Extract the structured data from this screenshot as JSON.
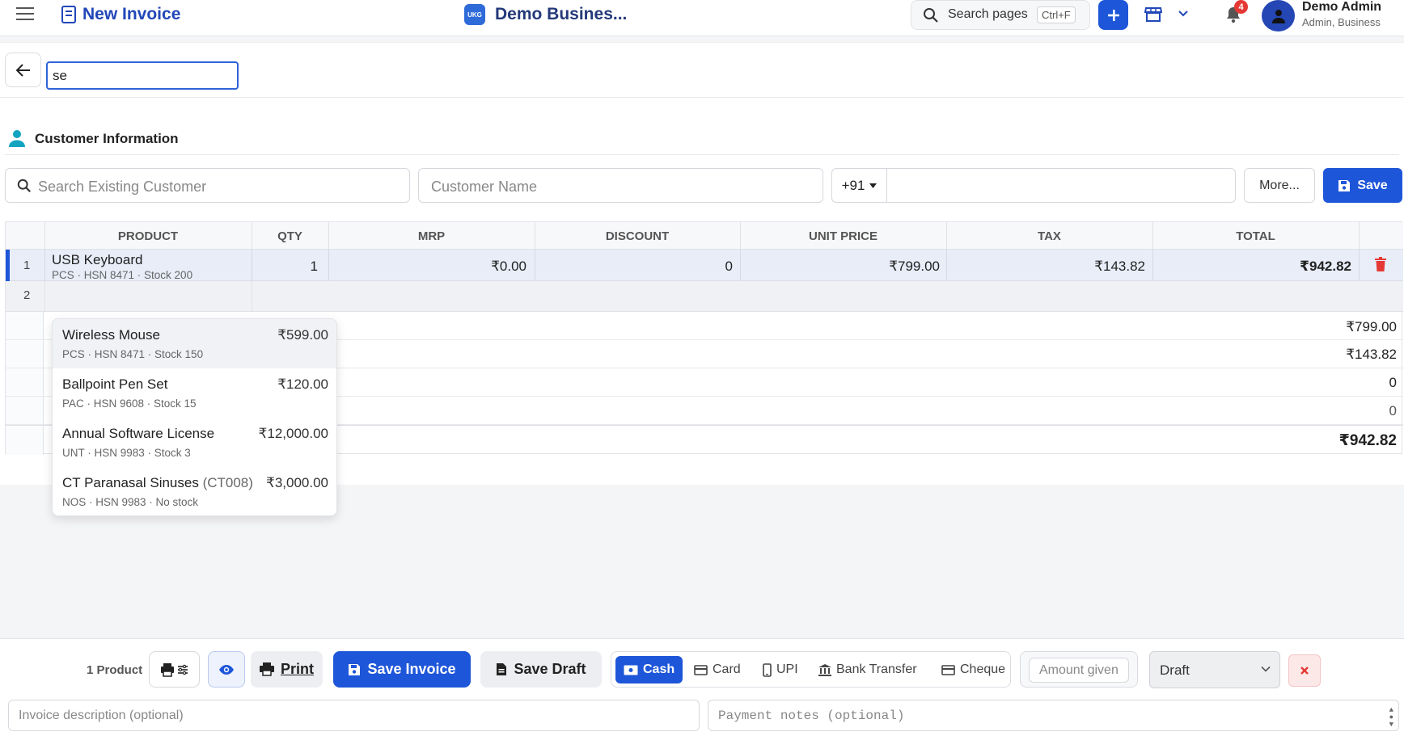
{
  "header": {
    "page_title": "New Invoice",
    "business_logo_text": "UKG",
    "business_name": "Demo Busines...",
    "search_label": "Search pages",
    "search_shortcut": "Ctrl+F",
    "notification_count": "4",
    "user_name": "Demo Admin",
    "user_role": "Admin, Business"
  },
  "customer": {
    "section_title": "Customer Information",
    "search_placeholder": "Search Existing Customer",
    "name_placeholder": "Customer Name",
    "country_code": "+91",
    "more_label": "More...",
    "save_label": "Save"
  },
  "table": {
    "columns": [
      "PRODUCT",
      "QTY",
      "MRP",
      "DISCOUNT",
      "UNIT PRICE",
      "TAX",
      "TOTAL"
    ],
    "rows": [
      {
        "num": "1",
        "name": "USB Keyboard",
        "meta": "PCS · HSN 8471 · Stock 200",
        "qty": "1",
        "mrp": "₹0.00",
        "discount": "0",
        "unit_price": "₹799.00",
        "tax": "₹143.82",
        "total": "₹942.82"
      }
    ],
    "new_row_num": "2",
    "new_row_input": "se",
    "summary": [
      "₹799.00",
      "₹143.82",
      "0",
      "0",
      "₹942.82"
    ]
  },
  "dropdown": {
    "items": [
      {
        "name": "Wireless Mouse",
        "code": "",
        "price": "₹599.00",
        "meta": "PCS · HSN 8471 · Stock 150"
      },
      {
        "name": "Ballpoint Pen Set",
        "code": "",
        "price": "₹120.00",
        "meta": "PAC · HSN 9608 · Stock 15"
      },
      {
        "name": "Annual Software License",
        "code": "",
        "price": "₹12,000.00",
        "meta": "UNT · HSN 9983 · Stock 3"
      },
      {
        "name": "CT Paranasal Sinuses",
        "code": "(CT008)",
        "price": "₹3,000.00",
        "meta": "NOS · HSN 9983 · No stock"
      }
    ]
  },
  "footer": {
    "product_count": "1 Product",
    "print_label": "Print",
    "save_invoice_label": "Save Invoice",
    "save_draft_label": "Save Draft",
    "payment_methods": [
      "Cash",
      "Card",
      "UPI",
      "Bank Transfer",
      "Cheque"
    ],
    "active_payment": "Cash",
    "amount_placeholder": "Amount given",
    "status_value": "Draft",
    "description_placeholder": "Invoice description (optional)",
    "notes_placeholder": "Payment notes (optional)"
  },
  "colors": {
    "primary": "#1e56d9",
    "title_blue": "#2147b8",
    "danger": "#e53935",
    "row_highlight": "#e8edf8"
  }
}
